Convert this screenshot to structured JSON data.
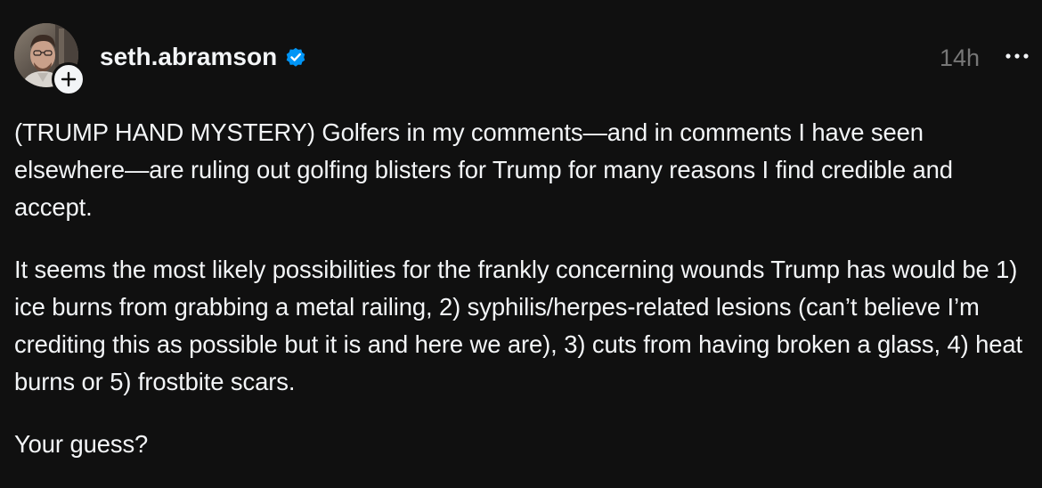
{
  "post": {
    "author": {
      "username": "seth.abramson",
      "verified": true,
      "avatar_icon": "profile-photo",
      "follow_icon": "plus-icon"
    },
    "timestamp": "14h",
    "more_icon": "ellipsis-icon",
    "paragraphs": [
      "(TRUMP HAND MYSTERY) Golfers in my comments—and in comments I have seen elsewhere—are ruling out golfing blisters for Trump for many reasons I find credible and accept.",
      "It seems the most likely possibilities for the frankly concerning wounds Trump has would be 1) ice burns from grabbing a metal railing, 2) syphilis/herpes-related lesions (can’t believe I’m crediting this as possible but it is and here we are), 3) cuts from having broken a glass, 4) heat burns or 5) frostbite scars.",
      "Your guess?"
    ]
  },
  "colors": {
    "background": "#101010",
    "text": "#f3f5f7",
    "muted": "#777777",
    "verified_blue": "#0095f6"
  }
}
